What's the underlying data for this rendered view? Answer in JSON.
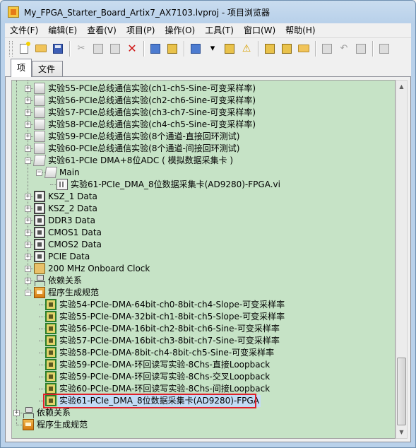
{
  "window": {
    "title": "My_FPGA_Starter_Board_Artix7_AX7103.lvproj - 项目浏览器"
  },
  "menu": [
    "文件(F)",
    "编辑(E)",
    "查看(V)",
    "项目(P)",
    "操作(O)",
    "工具(T)",
    "窗口(W)",
    "帮助(H)"
  ],
  "tabs": [
    {
      "label": "项",
      "active": true
    },
    {
      "label": "文件",
      "active": false
    }
  ],
  "tree": [
    {
      "label": "实验55-PCIe总线通信实验(ch1-ch5-Sine-可变采样率)",
      "icon": "folder-icon",
      "level": 1,
      "expander": "+"
    },
    {
      "label": "实验56-PCIe总线通信实验(ch2-ch6-Sine-可变采样率)",
      "icon": "folder-icon",
      "level": 1,
      "expander": "+"
    },
    {
      "label": "实验57-PCIe总线通信实验(ch3-ch7-Sine-可变采样率)",
      "icon": "folder-icon",
      "level": 1,
      "expander": "+"
    },
    {
      "label": "实验58-PCIe总线通信实验(ch4-ch5-Sine-可变采样率)",
      "icon": "folder-icon",
      "level": 1,
      "expander": "+"
    },
    {
      "label": "实验59-PCIe总线通信实验(8个通道-直接回环测试)",
      "icon": "folder-icon",
      "level": 1,
      "expander": "+"
    },
    {
      "label": "实验60-PCIe总线通信实验(8个通道-间接回环测试)",
      "icon": "folder-icon",
      "level": 1,
      "expander": "+"
    },
    {
      "label": "实验61-PCIe DMA+8位ADC ( 模拟数据采集卡 )",
      "icon": "folder-open-icon",
      "level": 1,
      "expander": "-"
    },
    {
      "label": "Main",
      "icon": "folder-open-icon",
      "level": 2,
      "expander": "-"
    },
    {
      "label": "实验61-PCIe_DMA_8位数据采集卡(AD9280)-FPGA.vi",
      "icon": "vi-icon",
      "level": 3,
      "expander": ""
    },
    {
      "label": "KSZ_1 Data",
      "icon": "chip-icon",
      "level": 1,
      "expander": "+"
    },
    {
      "label": "KSZ_2 Data",
      "icon": "chip-icon",
      "level": 1,
      "expander": "+"
    },
    {
      "label": "DDR3 Data",
      "icon": "chip-icon",
      "level": 1,
      "expander": "+"
    },
    {
      "label": "CMOS1 Data",
      "icon": "chip-icon",
      "level": 1,
      "expander": "+"
    },
    {
      "label": "CMOS2 Data",
      "icon": "chip-icon",
      "level": 1,
      "expander": "+"
    },
    {
      "label": "PCIE Data",
      "icon": "chip-icon",
      "level": 1,
      "expander": "+"
    },
    {
      "label": "200 MHz Onboard Clock",
      "icon": "clock-icon",
      "level": 1,
      "expander": "+"
    },
    {
      "label": "依赖关系",
      "icon": "dependencies-icon",
      "level": 1,
      "expander": "+"
    },
    {
      "label": "程序生成规范",
      "icon": "build-spec-icon",
      "level": 1,
      "expander": "-"
    },
    {
      "label": "实验54-PCIe-DMA-64bit-ch0-8bit-ch4-Slope-可变采样率",
      "icon": "bitfile-icon",
      "level": 2,
      "expander": ""
    },
    {
      "label": "实验55-PCIe-DMA-32bit-ch1-8bit-ch5-Slope-可变采样率",
      "icon": "bitfile-icon",
      "level": 2,
      "expander": ""
    },
    {
      "label": "实验56-PCIe-DMA-16bit-ch2-8bit-ch6-Sine-可变采样率",
      "icon": "bitfile-icon",
      "level": 2,
      "expander": ""
    },
    {
      "label": "实验57-PCIe-DMA-16bit-ch3-8bit-ch7-Sine-可变采样率",
      "icon": "bitfile-icon",
      "level": 2,
      "expander": ""
    },
    {
      "label": "实验58-PCIe-DMA-8bit-ch4-8bit-ch5-Sine-可变采样率",
      "icon": "bitfile-icon",
      "level": 2,
      "expander": ""
    },
    {
      "label": "实验59-PCIe-DMA-环回读写实验-8Chs-直接Loopback",
      "icon": "bitfile-icon",
      "level": 2,
      "expander": ""
    },
    {
      "label": "实验59-PCIe-DMA-环回读写实验-8Chs-交叉Loopback",
      "icon": "bitfile-icon",
      "level": 2,
      "expander": ""
    },
    {
      "label": "实验60-PCIe-DMA-环回读写实验-8Chs-间接Loopback",
      "icon": "bitfile-icon",
      "level": 2,
      "expander": ""
    },
    {
      "label": "实验61-PCIe_DMA_8位数据采集卡(AD9280)-FPGA",
      "icon": "bitfile-icon",
      "level": 2,
      "expander": "",
      "selected": true
    },
    {
      "label": "依赖关系",
      "icon": "dependencies-icon",
      "level": 0,
      "expander": "+"
    },
    {
      "label": "程序生成规范",
      "icon": "build-spec-icon",
      "level": 0,
      "expander": ""
    }
  ],
  "colors": {
    "tree_background": "#c6e3c6",
    "selection_highlight": "#e0202a"
  }
}
